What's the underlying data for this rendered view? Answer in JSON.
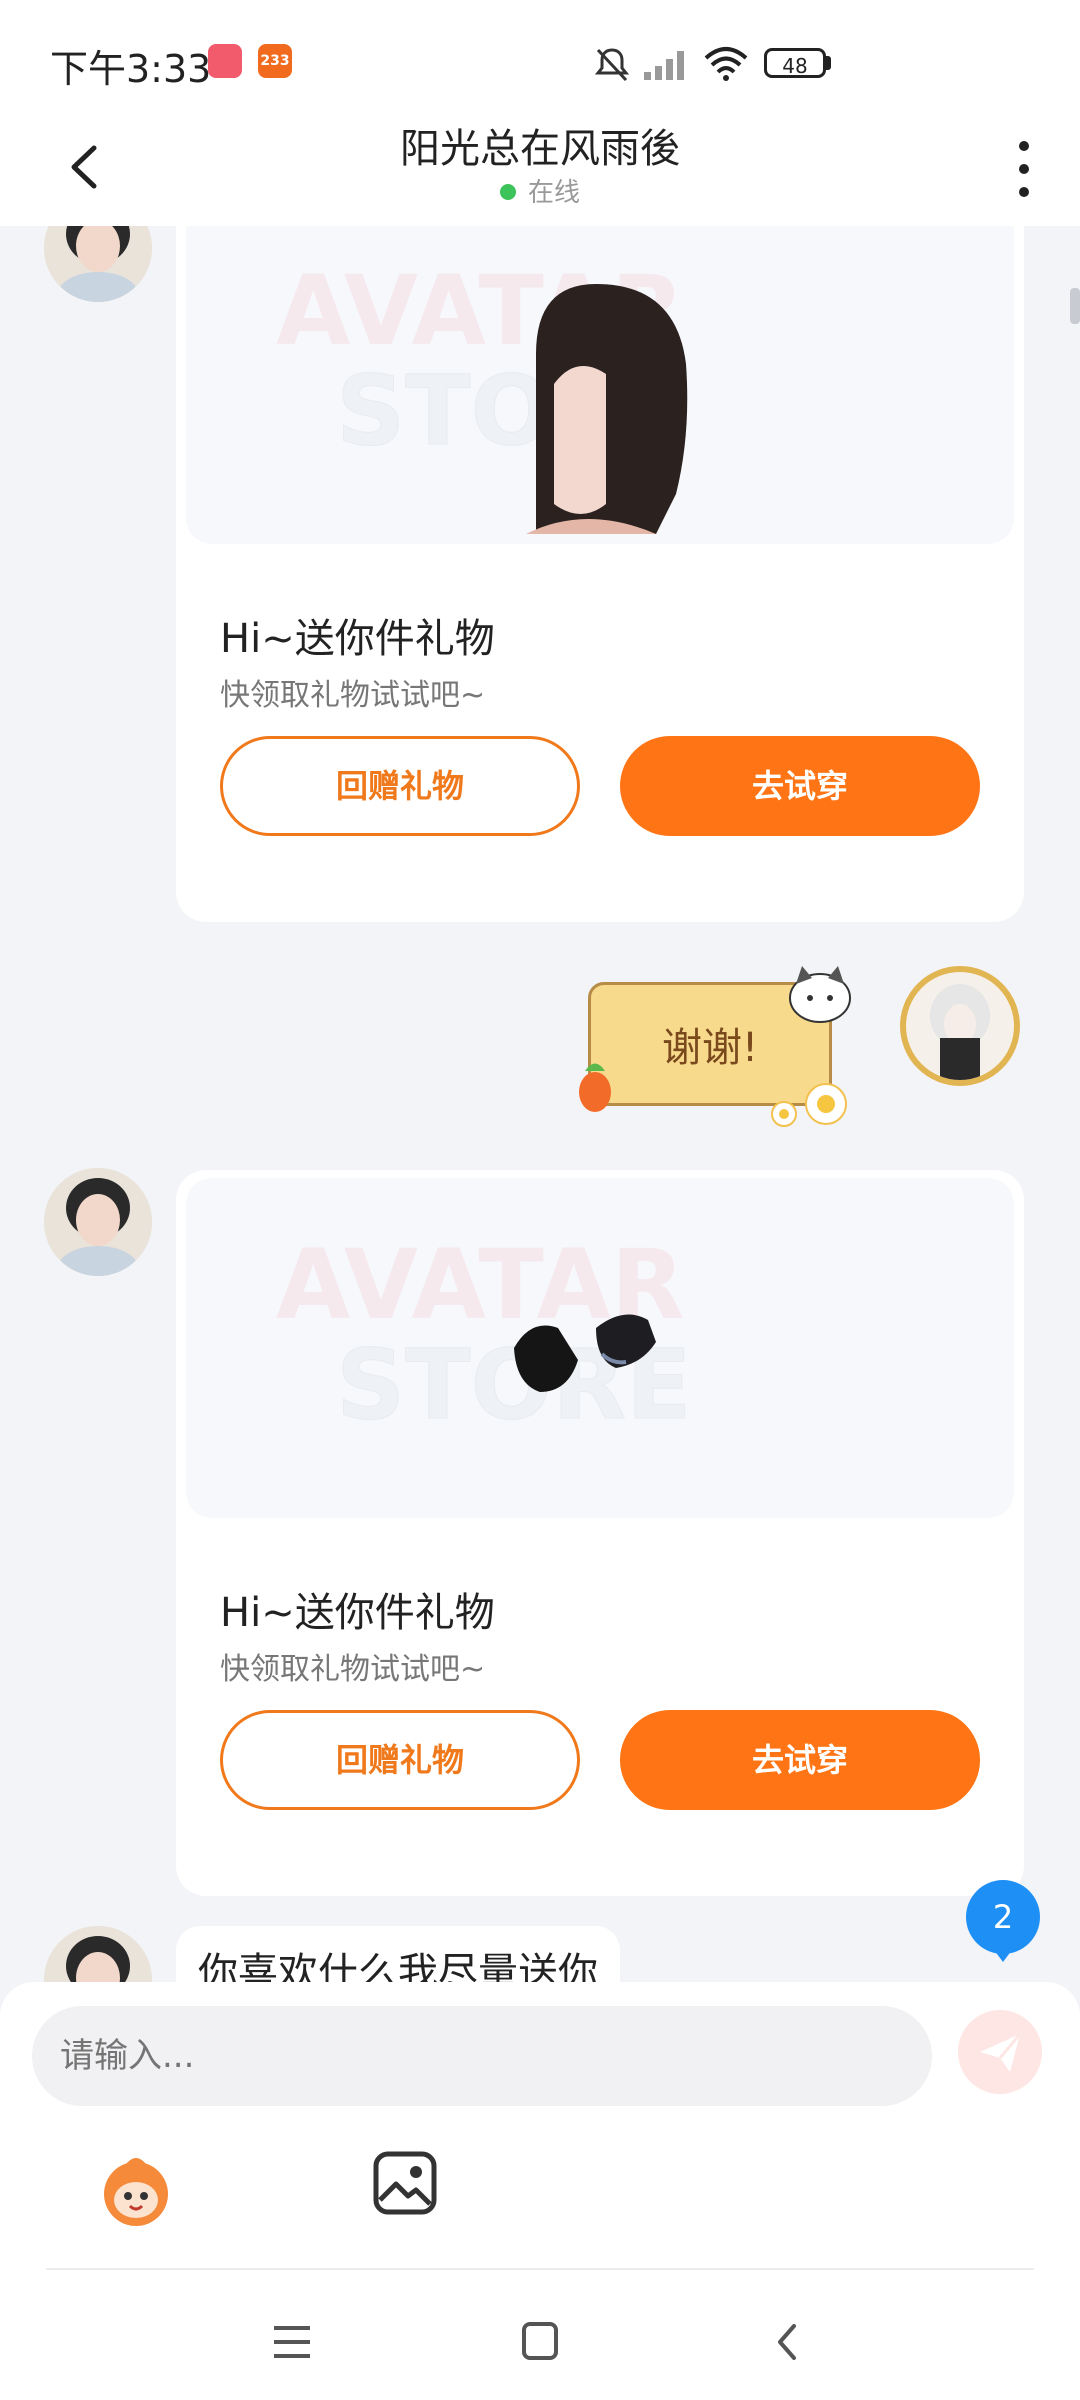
{
  "status_bar": {
    "time": "下午3:33",
    "badge_1": "",
    "badge_2": "233",
    "battery": "48"
  },
  "header": {
    "title": "阳光总在风雨後",
    "status": "在线"
  },
  "messages": [
    {
      "type": "gift_card",
      "image_watermark_line1": "AVATAR",
      "image_watermark_line2": "STORE",
      "title": "Hi~送你件礼物",
      "subtitle": "快领取礼物试试吧~",
      "secondary_button": "回赠礼物",
      "primary_button": "去试穿"
    },
    {
      "type": "sticker",
      "text": "谢谢!"
    },
    {
      "type": "gift_card",
      "image_watermark_line1": "AVATAR",
      "image_watermark_line2": "STORE",
      "title": "Hi~送你件礼物",
      "subtitle": "快领取礼物试试吧~",
      "secondary_button": "回赠礼物",
      "primary_button": "去试穿"
    },
    {
      "type": "text",
      "text": "你喜欢什么我尽量送你"
    }
  ],
  "unread_count": "2",
  "input": {
    "placeholder": "请输入..."
  },
  "colors": {
    "accent": "#FF7414",
    "online": "#3CC35A",
    "unread_badge": "#1E90F5",
    "background": "#F2F4F7"
  },
  "icons": [
    "back-icon",
    "more-icon",
    "send-icon",
    "avatar-emoji-icon",
    "image-icon",
    "menu-icon",
    "home-icon",
    "nav-back-icon",
    "mute-icon",
    "signal-icon",
    "wifi-icon"
  ]
}
